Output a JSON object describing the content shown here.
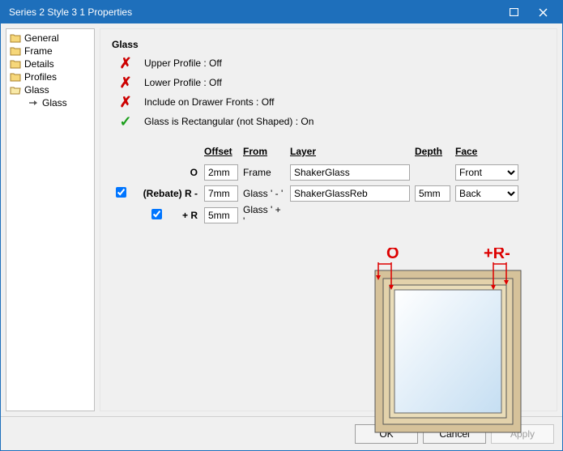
{
  "window": {
    "title": "Series 2 Style 3 1 Properties"
  },
  "sidebar": {
    "items": [
      {
        "label": "General"
      },
      {
        "label": "Frame"
      },
      {
        "label": "Details"
      },
      {
        "label": "Profiles"
      },
      {
        "label": "Glass"
      }
    ],
    "subitem": {
      "label": "Glass"
    }
  },
  "section": {
    "title": "Glass"
  },
  "props": [
    {
      "state": "off",
      "label": "Upper Profile : Off"
    },
    {
      "state": "off",
      "label": "Lower Profile : Off"
    },
    {
      "state": "off",
      "label": "Include on Drawer Fronts : Off"
    },
    {
      "state": "on",
      "label": "Glass is Rectangular (not Shaped) : On"
    }
  ],
  "grid": {
    "headers": {
      "offset": "Offset",
      "from": "From",
      "layer": "Layer",
      "depth": "Depth",
      "face": "Face"
    },
    "rows": [
      {
        "chk": null,
        "label": "O",
        "offset": "2mm",
        "from": "Frame",
        "layer": "ShakerGlass",
        "depth": "",
        "face": "Front"
      },
      {
        "chk": true,
        "label": "(Rebate) R -",
        "offset": "7mm",
        "from": "Glass ' - '",
        "layer": "ShakerGlassReb",
        "depth": "5mm",
        "face": "Back"
      },
      {
        "chk": true,
        "label": "+ R",
        "offset": "5mm",
        "from": "Glass ' + '",
        "layer": "",
        "depth": "",
        "face": ""
      }
    ]
  },
  "diagram": {
    "labelO": "O",
    "labelR": "+R-"
  },
  "footer": {
    "ok": "OK",
    "cancel": "Cancel",
    "apply": "Apply"
  },
  "colors": {
    "accent": "#1e6fbb",
    "frameWood": "#d6c29a",
    "frameWoodDark": "#c0a876",
    "glassLight": "#ffffff",
    "glassBlue": "#cfe4f6"
  }
}
